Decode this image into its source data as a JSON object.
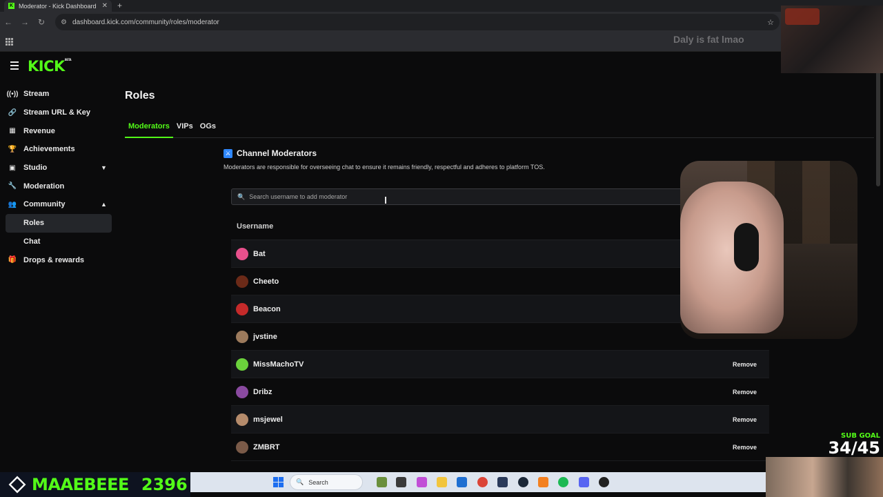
{
  "browser": {
    "tab_title": "Moderator - Kick Dashboard",
    "tab_favicon": "K",
    "url": "dashboard.kick.com/community/roles/moderator"
  },
  "overlay_message": "Daly is fat lmao",
  "app": {
    "logo": "KICK",
    "logo_badge": "BETA"
  },
  "sidebar": {
    "items": [
      {
        "label": "Stream",
        "icon": "broadcast-icon"
      },
      {
        "label": "Stream URL & Key",
        "icon": "link-icon"
      },
      {
        "label": "Revenue",
        "icon": "bank-icon"
      },
      {
        "label": "Achievements",
        "icon": "trophy-icon"
      },
      {
        "label": "Studio",
        "icon": "studio-icon",
        "expandable": true
      },
      {
        "label": "Moderation",
        "icon": "wrench-icon"
      },
      {
        "label": "Community",
        "icon": "people-icon",
        "expanded": true
      },
      {
        "label": "Roles",
        "sub": true,
        "active": true
      },
      {
        "label": "Chat",
        "sub": true
      },
      {
        "label": "Drops & rewards",
        "icon": "gift-icon"
      }
    ]
  },
  "main": {
    "title": "Roles",
    "tabs": [
      "Moderators",
      "VIPs",
      "OGs"
    ],
    "active_tab": "Moderators",
    "section_title": "Channel Moderators",
    "section_desc": "Moderators are responsible for overseeing chat to ensure it remains friendly, respectful and adheres to platform TOS.",
    "search_placeholder": "Search username to add moderator",
    "column_header": "Username",
    "remove_label": "Remove",
    "moderators": [
      {
        "name": "Bat",
        "color": "#e8508c"
      },
      {
        "name": "Cheeto",
        "color": "#6b2a18"
      },
      {
        "name": "Beacon",
        "color": "#c52a2a"
      },
      {
        "name": "jvstine",
        "color": "#9c7a5c"
      },
      {
        "name": "MissMachoTV",
        "color": "#6bd13c"
      },
      {
        "name": "Dribz",
        "color": "#8a4aa0"
      },
      {
        "name": "msjewel",
        "color": "#b58b6b"
      },
      {
        "name": "ZMBRT",
        "color": "#7a5a48"
      }
    ]
  },
  "stream_overlay": {
    "username": "MAAEBEEE",
    "count": "2396",
    "sub_goal_label": "SUB GOAL",
    "sub_goal_value": "34/45"
  },
  "taskbar": {
    "search_label": "Search"
  },
  "colors": {
    "accent": "#53fc18",
    "background": "#0b0b0c"
  }
}
